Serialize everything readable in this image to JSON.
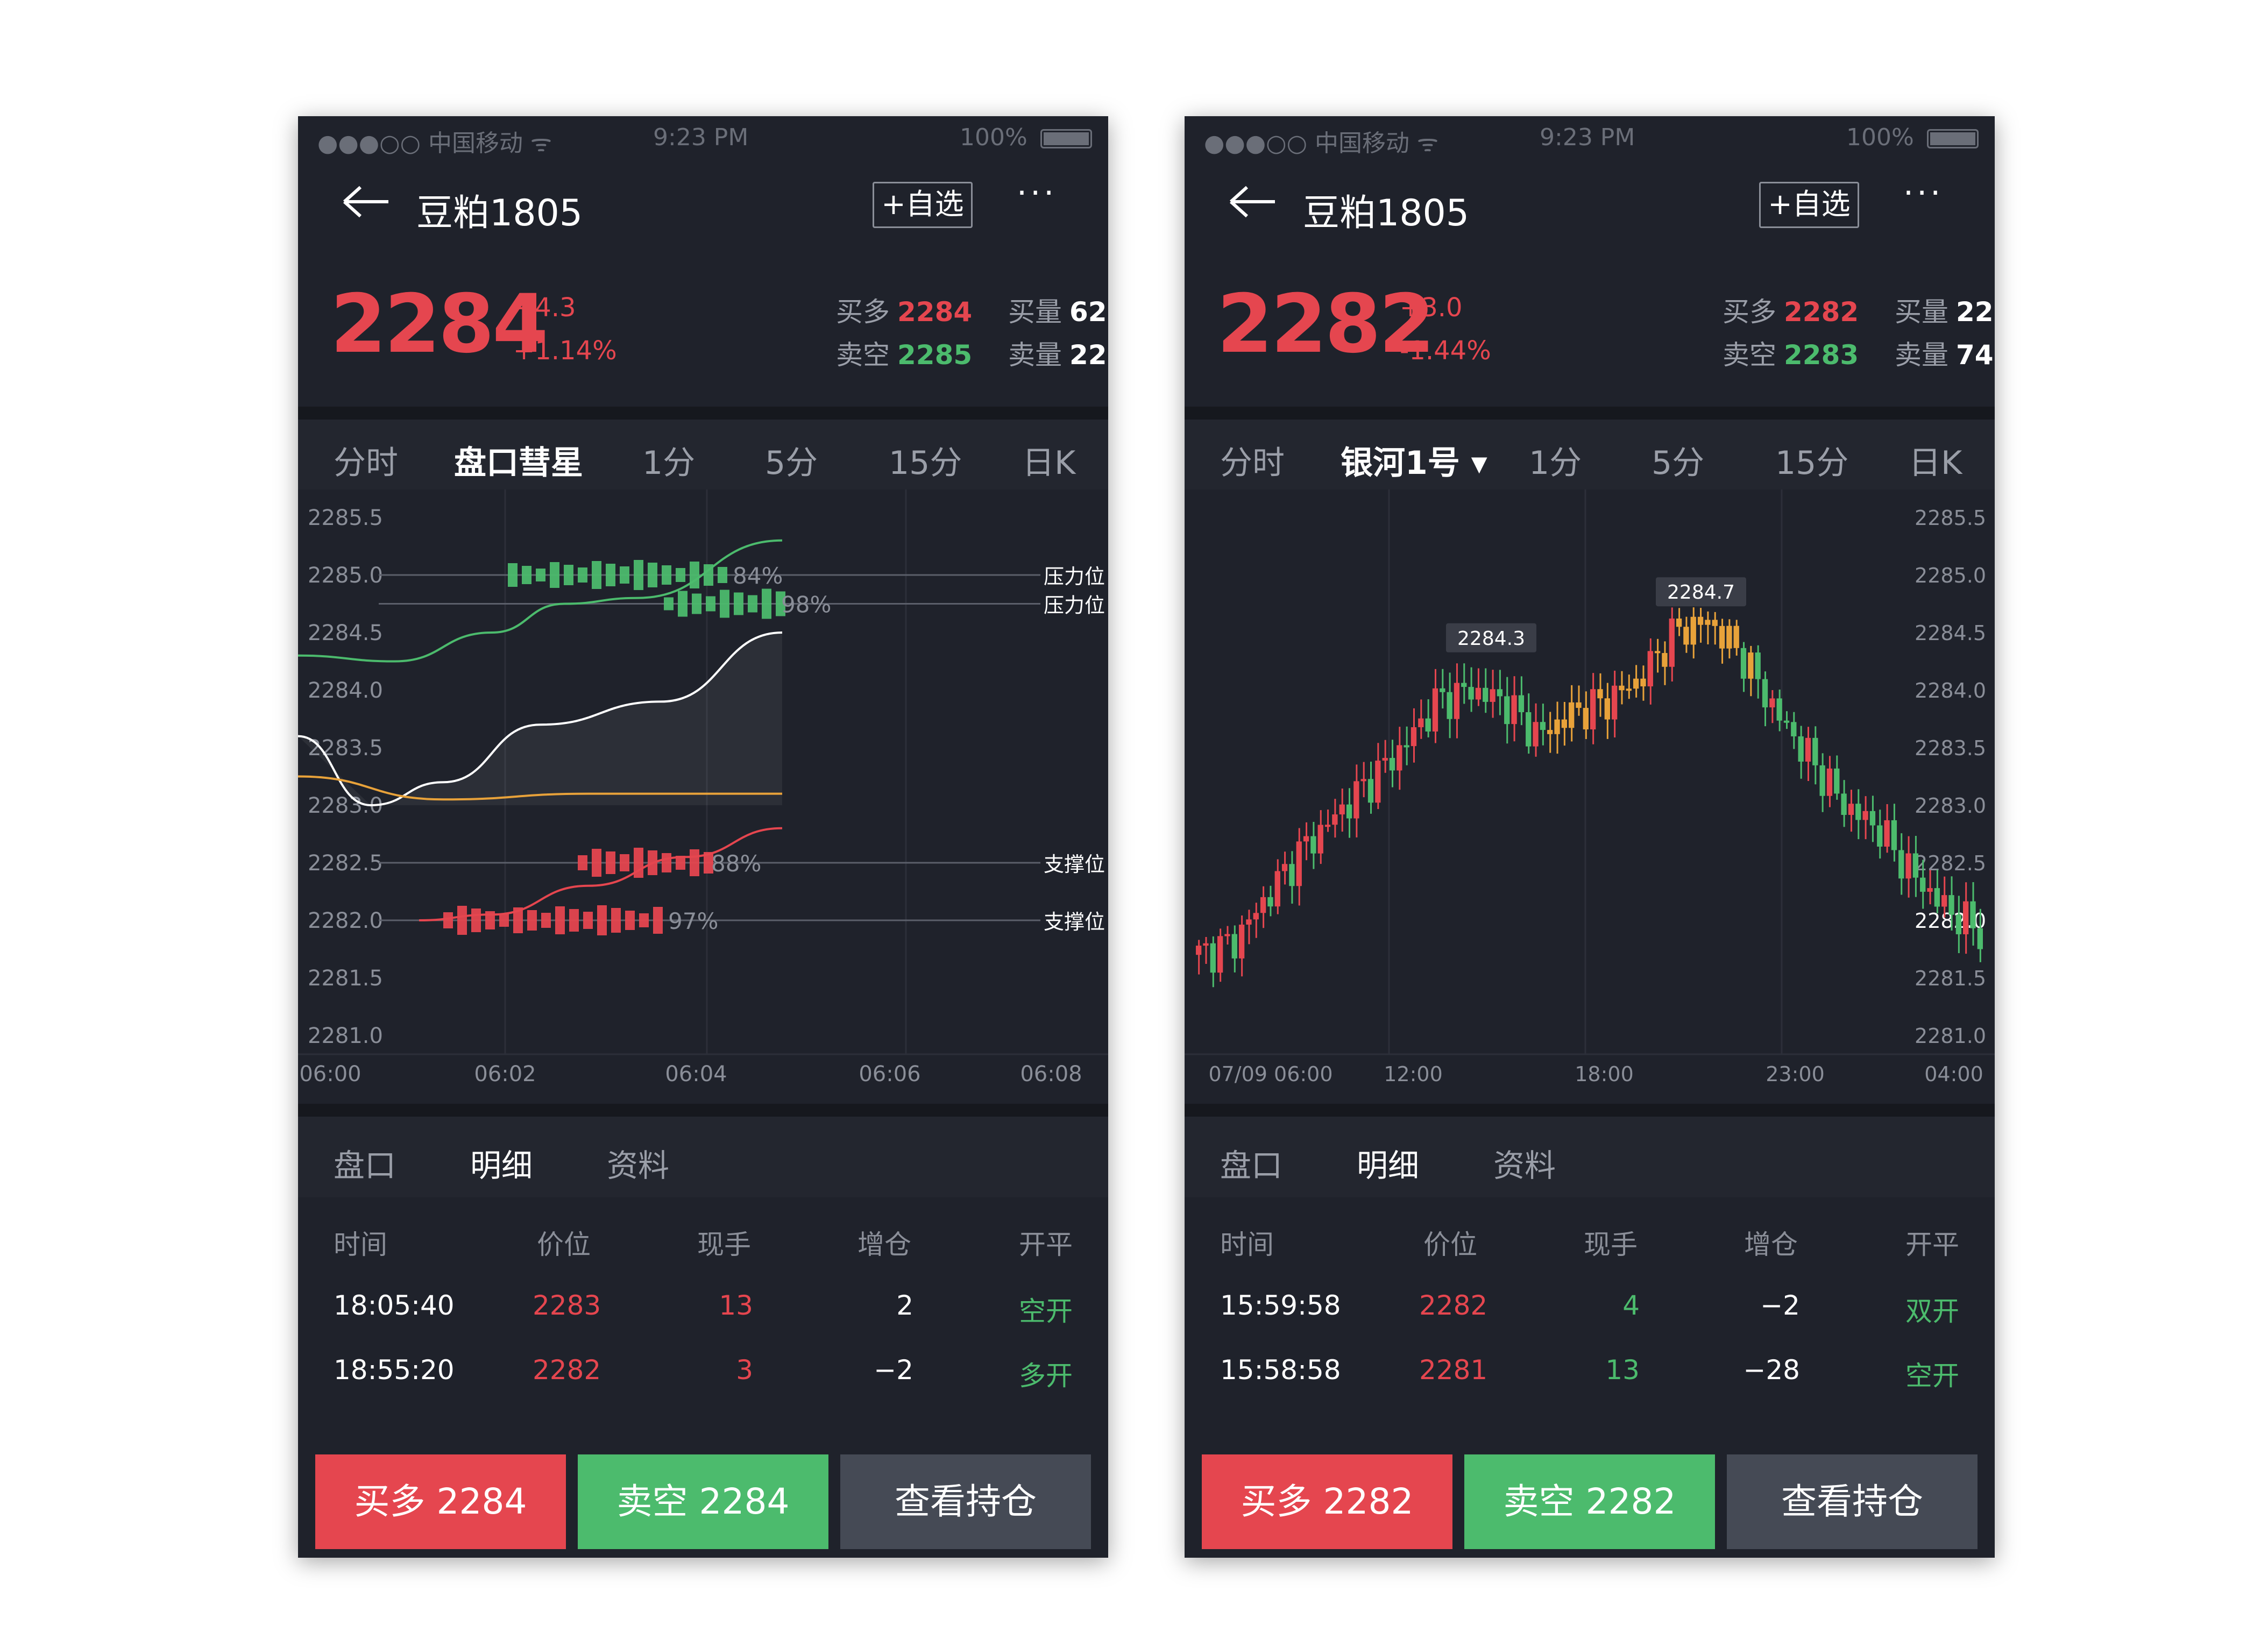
{
  "phones": [
    {
      "status": {
        "carrier": "●●●○○ 中国移动 ᯤ",
        "time": "9:23 PM",
        "battery": "100%"
      },
      "nav": {
        "title": "豆粕1805",
        "fav": "+自选",
        "more": "···"
      },
      "quote": {
        "price": "2284",
        "change": "+4.3",
        "change_pct": "+1.14%",
        "buy_label": "买多",
        "buy_price": "2284",
        "sell_label": "卖空",
        "sell_price": "2285",
        "buy_vol_label": "买量",
        "buy_vol": "62",
        "sell_vol_label": "卖量",
        "sell_vol": "22"
      },
      "tabs": [
        "分时",
        "盘口彗星",
        "1分",
        "5分",
        "15分",
        "日K"
      ],
      "chart_data": {
        "type": "line",
        "y_ticks": [
          "2285.5",
          "2285.0",
          "2284.5",
          "2284.0",
          "2283.5",
          "2283.0",
          "2282.5",
          "2282.0",
          "2281.5",
          "2281.0"
        ],
        "x_ticks": [
          "06:00",
          "06:02",
          "06:04",
          "06:06",
          "06:08"
        ],
        "levels": [
          {
            "label": "压力位",
            "price": 2285.0,
            "pct": "84%",
            "color": "#4cbb6d"
          },
          {
            "label": "压力位",
            "price": 2284.75,
            "pct": "98%",
            "color": "#4cbb6d"
          },
          {
            "label": "支撑位",
            "price": 2282.5,
            "pct": "88%",
            "color": "#e5464f"
          },
          {
            "label": "支撑位",
            "price": 2282.0,
            "pct": "97%",
            "color": "#e5464f"
          }
        ],
        "series": [
          {
            "color": "#4cbb6d",
            "x": [
              0,
              0.2,
              0.4,
              0.55,
              0.7,
              1.0
            ],
            "y": [
              2284.3,
              2284.25,
              2284.5,
              2284.75,
              2284.8,
              2285.3
            ]
          },
          {
            "color": "#ffffff",
            "x": [
              0,
              0.15,
              0.3,
              0.5,
              0.75,
              1.0
            ],
            "y": [
              2283.6,
              2283.0,
              2283.2,
              2283.7,
              2283.9,
              2284.5
            ]
          },
          {
            "color": "#e8a23a",
            "x": [
              0,
              0.3,
              0.6,
              1.0
            ],
            "y": [
              2283.25,
              2283.05,
              2283.1,
              2283.1
            ]
          },
          {
            "color": "#e5464f",
            "x": [
              0.25,
              0.4,
              0.6,
              0.8,
              1.0
            ],
            "y": [
              2282.0,
              2282.05,
              2282.3,
              2282.55,
              2282.8
            ]
          }
        ]
      },
      "bottom_tabs": [
        "盘口",
        "明细",
        "资料"
      ],
      "table": {
        "headers": [
          "时间",
          "价位",
          "现手",
          "增仓",
          "开平"
        ],
        "rows": [
          {
            "time": "18:05:40",
            "price": "2283",
            "vol": "13",
            "oi": "2",
            "type": "空开",
            "vol_color": "red"
          },
          {
            "time": "18:55:20",
            "price": "2282",
            "vol": "3",
            "oi": "−2",
            "type": "多开",
            "vol_color": "red"
          }
        ]
      },
      "buttons": {
        "buy": "买多 2284",
        "sell": "卖空 2284",
        "view": "查看持仓"
      }
    },
    {
      "status": {
        "carrier": "●●●○○ 中国移动 ᯤ",
        "time": "9:23 PM",
        "battery": "100%"
      },
      "nav": {
        "title": "豆粕1805",
        "fav": "+自选",
        "more": "···"
      },
      "quote": {
        "price": "2282",
        "change": "+3.0",
        "change_pct": "-1.44%",
        "buy_label": "买多",
        "buy_price": "2282",
        "sell_label": "卖空",
        "sell_price": "2283",
        "buy_vol_label": "买量",
        "buy_vol": "22",
        "sell_vol_label": "卖量",
        "sell_vol": "74"
      },
      "tabs": [
        "分时",
        "银河1号 ▾",
        "1分",
        "5分",
        "15分",
        "日K"
      ],
      "chart_data": {
        "type": "candlestick",
        "y_ticks": [
          "2285.5",
          "2285.0",
          "2284.5",
          "2284.0",
          "2283.5",
          "2283.0",
          "2282.5",
          "2282.0",
          "2281.5",
          "2281.0"
        ],
        "x_ticks": [
          "07/09 06:00",
          "12:00",
          "18:00",
          "23:00",
          "04:00"
        ],
        "annotations": [
          {
            "label": "2284.3"
          },
          {
            "label": "2284.7"
          }
        ],
        "path": [
          2281.7,
          2281.8,
          2282.2,
          2282.6,
          2282.9,
          2283.2,
          2283.5,
          2283.9,
          2284.0,
          2283.9,
          2283.6,
          2283.8,
          2283.9,
          2284.1,
          2284.5,
          2284.6,
          2284.3,
          2283.8,
          2283.4,
          2283.0,
          2282.8,
          2282.4,
          2282.1,
          2281.9
        ]
      },
      "bottom_tabs": [
        "盘口",
        "明细",
        "资料"
      ],
      "table": {
        "headers": [
          "时间",
          "价位",
          "现手",
          "增仓",
          "开平"
        ],
        "rows": [
          {
            "time": "15:59:58",
            "price": "2282",
            "vol": "4",
            "oi": "−2",
            "type": "双开",
            "vol_color": "green"
          },
          {
            "time": "15:58:58",
            "price": "2281",
            "vol": "13",
            "oi": "−28",
            "type": "空开",
            "vol_color": "green"
          }
        ]
      },
      "buttons": {
        "buy": "买多 2282",
        "sell": "卖空 2282",
        "view": "查看持仓"
      }
    }
  ]
}
